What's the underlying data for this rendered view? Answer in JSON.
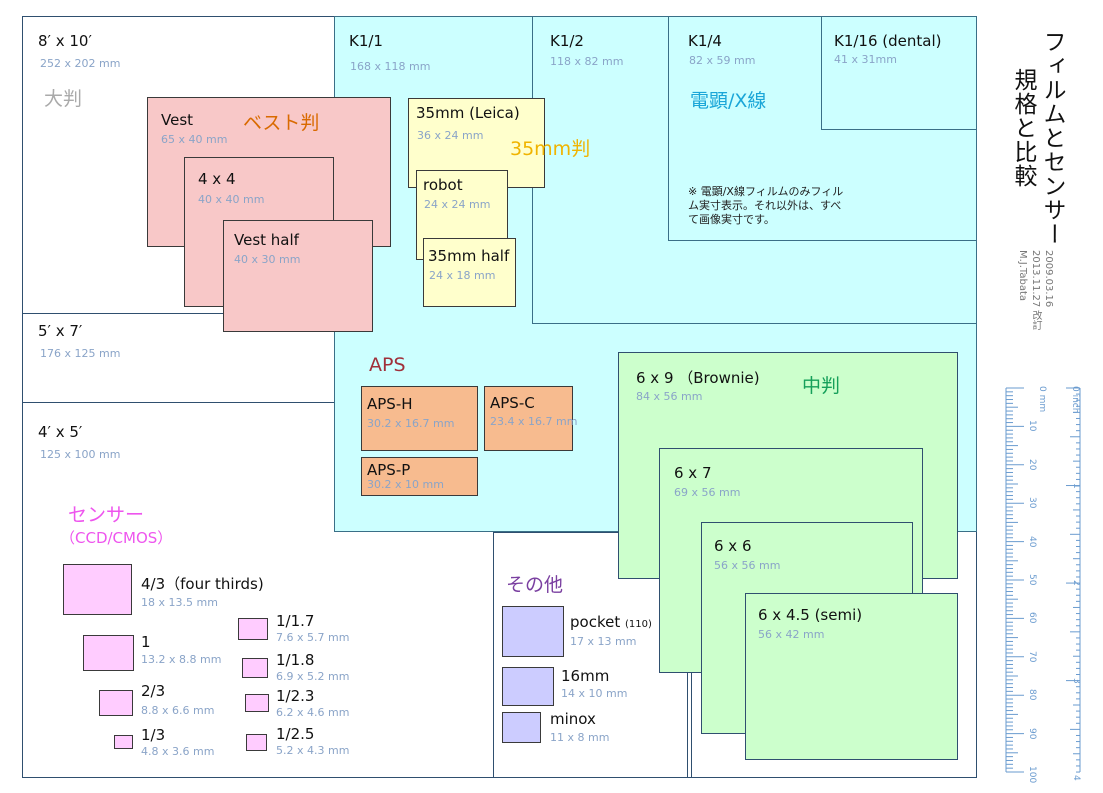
{
  "title_line1": "フィルムとセンサー",
  "title_line2": "規格と比較",
  "dates": [
    "2009.03.16",
    "2013.11.27 改訂",
    "M.J.Tabata"
  ],
  "groups": {
    "large": "大判",
    "vest": "ベスト判",
    "mm35": "35mm判",
    "denken": "電顕/X線",
    "aps": "APS",
    "medium": "中判",
    "sensor": "センサー",
    "sensor_sub": "（CCD/CMOS）",
    "other": "その他"
  },
  "note": "※ 電顕/X線フィルムのみフィルム実寸表示。それ以外は、すべて画像実寸です。",
  "formats": {
    "f8x10": {
      "name": "8′ x 10′",
      "dim": "252 x 202 mm"
    },
    "f5x7": {
      "name": "5′ x 7′",
      "dim": "176 x 125 mm"
    },
    "f4x5": {
      "name": "4′ x 5′",
      "dim": "125 x 100 mm"
    },
    "k1": {
      "name": "K1/1",
      "dim": "168 x 118 mm"
    },
    "k2": {
      "name": "K1/2",
      "dim": "118 x 82 mm"
    },
    "k4": {
      "name": "K1/4",
      "dim": "82 x 59 mm"
    },
    "k16": {
      "name": "K1/16 (dental)",
      "dim": "41 x 31mm"
    },
    "vest": {
      "name": "Vest",
      "dim": "65 x 40 mm"
    },
    "v44": {
      "name": "4 x 4",
      "dim": "40 x 40 mm"
    },
    "vesthalf": {
      "name": "Vest half",
      "dim": "40 x 30 mm"
    },
    "leica": {
      "name": "35mm (Leica)",
      "dim": "36 x 24 mm"
    },
    "robot": {
      "name": "robot",
      "dim": "24 x 24 mm"
    },
    "half35": {
      "name": "35mm half",
      "dim": "24 x 18 mm"
    },
    "apsh": {
      "name": "APS-H",
      "dim": "30.2 x 16.7 mm"
    },
    "apsc": {
      "name": "APS-C",
      "dim": "23.4 x 16.7 mm"
    },
    "apsp": {
      "name": "APS-P",
      "dim": "30.2 x 10 mm"
    },
    "m69": {
      "name": "6 x 9 （Brownie)",
      "dim": "84 x 56 mm"
    },
    "m67": {
      "name": "6 x 7",
      "dim": "69 x 56 mm"
    },
    "m66": {
      "name": "6 x 6",
      "dim": "56 x 56 mm"
    },
    "m645": {
      "name": "6 x 4.5 (semi)",
      "dim": "56 x 42 mm"
    },
    "s43": {
      "name": "4/3（four thirds)",
      "dim": "18 x 13.5 mm"
    },
    "s1": {
      "name": "1",
      "dim": "13.2 x 8.8 mm"
    },
    "s23": {
      "name": "2/3",
      "dim": "8.8 x 6.6 mm"
    },
    "s13": {
      "name": "1/3",
      "dim": "4.8 x 3.6 mm"
    },
    "s117": {
      "name": "1/1.7",
      "dim": "7.6 x 5.7 mm"
    },
    "s118": {
      "name": "1/1.8",
      "dim": "6.9 x 5.2 mm"
    },
    "s123": {
      "name": "1/2.3",
      "dim": "6.2 x 4.6 mm"
    },
    "s125": {
      "name": "1/2.5",
      "dim": "5.2 x 4.3 mm"
    },
    "pocket": {
      "name": "pocket",
      "suffix": "(110)",
      "dim": "17 x 13 mm"
    },
    "m16": {
      "name": "16mm",
      "dim": "14 x 10 mm"
    },
    "minox": {
      "name": "minox",
      "dim": "11 x 8 mm"
    }
  },
  "ruler": {
    "mm_unit": "0 mm",
    "inch_unit": "0 inch",
    "mm_ticks": [
      "10",
      "20",
      "30",
      "40",
      "50",
      "60",
      "70",
      "80",
      "90",
      "100"
    ],
    "inch_ticks": [
      "1",
      "2",
      "3",
      "4"
    ]
  }
}
